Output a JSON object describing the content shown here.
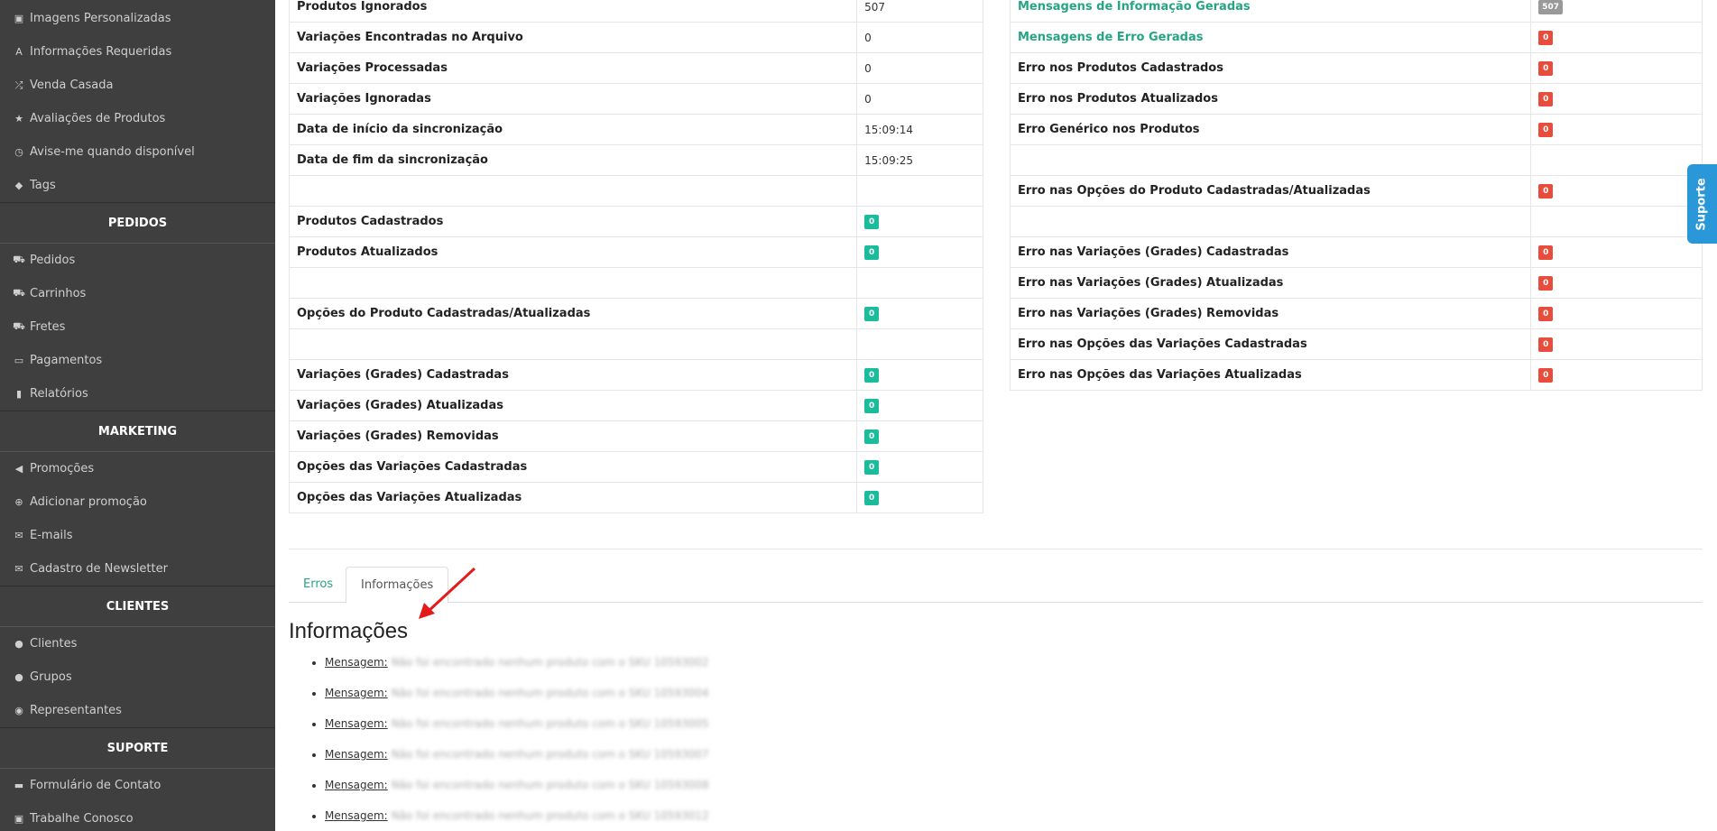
{
  "sidebar": {
    "items_top": [
      {
        "label": "Imagens Personalizadas",
        "icon": "image-icon"
      },
      {
        "label": "Informações Requeridas",
        "icon": "font-icon"
      },
      {
        "label": "Venda Casada",
        "icon": "shuffle-icon"
      },
      {
        "label": "Avaliações de Produtos",
        "icon": "star-icon"
      },
      {
        "label": "Avise-me quando disponível",
        "icon": "clock-icon"
      },
      {
        "label": "Tags",
        "icon": "tag-icon"
      }
    ],
    "section_pedidos": "PEDIDOS",
    "items_pedidos": [
      {
        "label": "Pedidos",
        "icon": "cart-icon"
      },
      {
        "label": "Carrinhos",
        "icon": "cart-icon"
      },
      {
        "label": "Fretes",
        "icon": "truck-icon"
      },
      {
        "label": "Pagamentos",
        "icon": "credit-card-icon"
      },
      {
        "label": "Relatórios",
        "icon": "bar-chart-icon"
      }
    ],
    "section_marketing": "MARKETING",
    "items_marketing": [
      {
        "label": "Promoções",
        "icon": "bullhorn-icon"
      },
      {
        "label": "Adicionar promoção",
        "icon": "plus-circle-icon"
      },
      {
        "label": "E-mails",
        "icon": "envelope-icon"
      },
      {
        "label": "Cadastro de Newsletter",
        "icon": "envelope-icon"
      }
    ],
    "section_clientes": "CLIENTES",
    "items_clientes": [
      {
        "label": "Clientes",
        "icon": "user-icon"
      },
      {
        "label": "Grupos",
        "icon": "users-icon"
      },
      {
        "label": "Representantes",
        "icon": "user-circle-icon"
      }
    ],
    "section_suporte": "SUPORTE",
    "items_suporte": [
      {
        "label": "Formulário de Contato",
        "icon": "comment-icon"
      },
      {
        "label": "Trabalhe Conosco",
        "icon": "briefcase-icon"
      }
    ]
  },
  "left_table": {
    "rows": [
      {
        "label": "Produtos Ignorados",
        "value": "507"
      },
      {
        "label": "Variações Encontradas no Arquivo",
        "value": "0"
      },
      {
        "label": "Variações Processadas",
        "value": "0"
      },
      {
        "label": "Variações Ignoradas",
        "value": "0"
      },
      {
        "label": "Data de início da sincronização",
        "value": "15:09:14"
      },
      {
        "label": "Data de fim da sincronização",
        "value": "15:09:25"
      },
      {
        "label": "Produtos Cadastrados",
        "badge": "0"
      },
      {
        "label": "Produtos Atualizados",
        "badge": "0"
      },
      {
        "label": "Opções do Produto Cadastradas/Atualizadas",
        "badge": "0"
      },
      {
        "label": "Variações (Grades) Cadastradas",
        "badge": "0"
      },
      {
        "label": "Variações (Grades) Atualizadas",
        "badge": "0"
      },
      {
        "label": "Variações (Grades) Removidas",
        "badge": "0"
      },
      {
        "label": "Opções das Variações Cadastradas",
        "badge": "0"
      },
      {
        "label": "Opções das Variações Atualizadas",
        "badge": "0"
      }
    ]
  },
  "right_table": {
    "rows": [
      {
        "label": "Mensagens de Informação Geradas",
        "badge": "507"
      },
      {
        "label": "Mensagens de Erro Geradas",
        "badge": "0"
      },
      {
        "label": "Erro nos Produtos Cadastrados",
        "badge": "0"
      },
      {
        "label": "Erro nos Produtos Atualizados",
        "badge": "0"
      },
      {
        "label": "Erro Genérico nos Produtos",
        "badge": "0"
      },
      {
        "label": "Erro nas Opções do Produto Cadastradas/Atualizadas",
        "badge": "0"
      },
      {
        "label": "Erro nas Variações (Grades) Cadastradas",
        "badge": "0"
      },
      {
        "label": "Erro nas Variações (Grades) Atualizadas",
        "badge": "0"
      },
      {
        "label": "Erro nas Variações (Grades) Removidas",
        "badge": "0"
      },
      {
        "label": "Erro nas Opções das Variações Cadastradas",
        "badge": "0"
      },
      {
        "label": "Erro nas Opções das Variações Atualizadas",
        "badge": "0"
      }
    ]
  },
  "tabs": {
    "erros": "Erros",
    "informacoes": "Informações"
  },
  "section_title": "Informações",
  "messages": [
    {
      "label": "Mensagem:",
      "text": "Não foi encontrado nenhum produto com o SKU 10593002"
    },
    {
      "label": "Mensagem:",
      "text": "Não foi encontrado nenhum produto com o SKU 10593004"
    },
    {
      "label": "Mensagem:",
      "text": "Não foi encontrado nenhum produto com o SKU 10593005"
    },
    {
      "label": "Mensagem:",
      "text": "Não foi encontrado nenhum produto com o SKU 10593007"
    },
    {
      "label": "Mensagem:",
      "text": "Não foi encontrado nenhum produto com o SKU 10593008"
    },
    {
      "label": "Mensagem:",
      "text": "Não foi encontrado nenhum produto com o SKU 10593012"
    }
  ],
  "suporte_label": "Suporte",
  "colors": {
    "sidebar_bg": "#3f3f3f",
    "accent_green": "#26a483",
    "badge_green": "#1abc9c",
    "badge_red": "#e74c3c",
    "badge_gray": "#999999",
    "suporte_blue": "#2a97d8",
    "arrow_red": "#e31b1b"
  }
}
